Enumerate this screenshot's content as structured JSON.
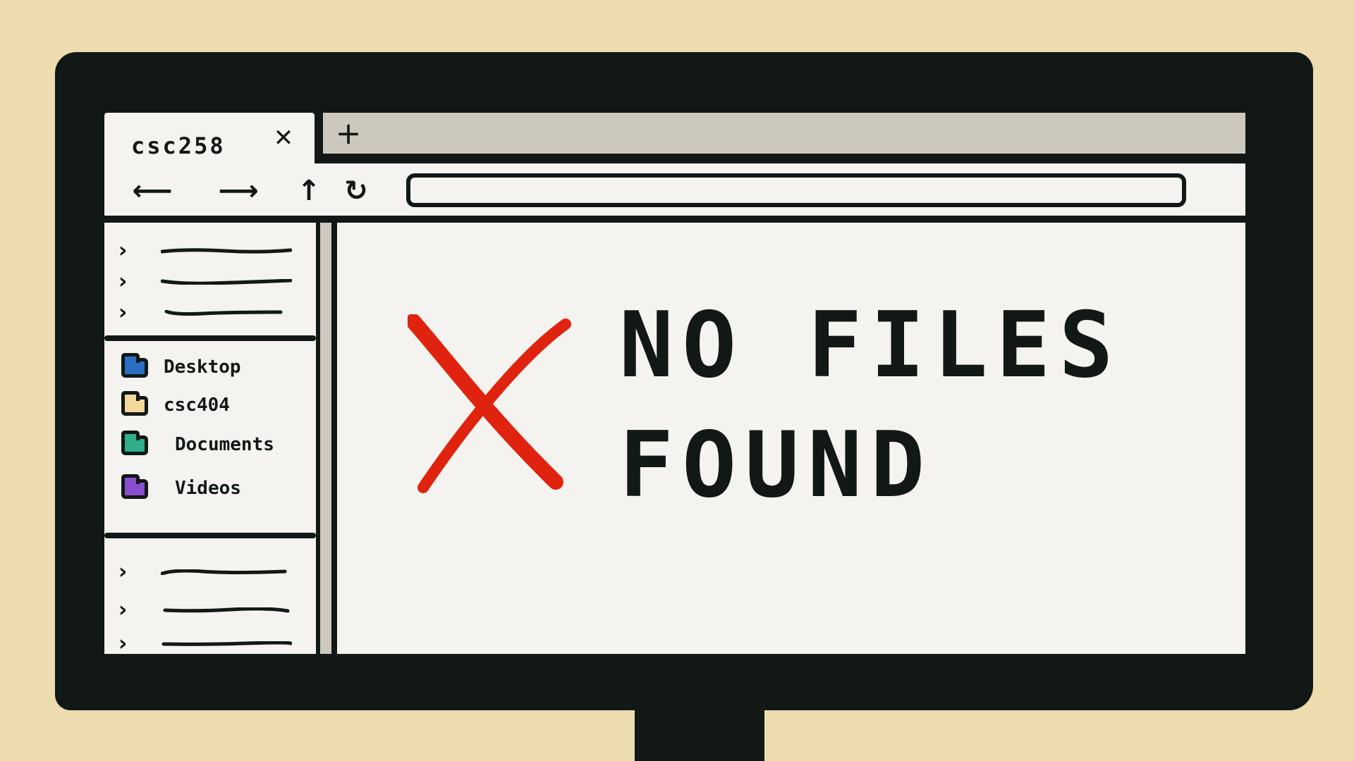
{
  "colors": {
    "background": "#ecdcae",
    "monitor": "#111816",
    "window": "#f4f3ef",
    "chrome": "#cdc8bd",
    "error_accent": "#e0230e"
  },
  "tabs": [
    {
      "label": "csc258",
      "close_icon": "close-icon"
    }
  ],
  "new_tab_icon": "plus-icon",
  "toolbar": {
    "back_icon": "arrow-left-icon",
    "forward_icon": "arrow-right-icon",
    "up_icon": "arrow-up-icon",
    "refresh_icon": "refresh-icon",
    "address_value": ""
  },
  "sidebar": {
    "places": [
      {
        "label": "Desktop",
        "icon": "desktop-folder-icon",
        "color": "#2a6fc4"
      },
      {
        "label": "csc404",
        "icon": "folder-icon",
        "color": "#f2d89a"
      },
      {
        "label": "Documents",
        "icon": "documents-folder-icon",
        "color": "#2fae8a"
      },
      {
        "label": "Videos",
        "icon": "videos-folder-icon",
        "color": "#8a4fd0"
      }
    ]
  },
  "main": {
    "empty_state": {
      "icon": "error-x-icon",
      "line1": "NO FILES",
      "line2": "FOUND"
    }
  }
}
